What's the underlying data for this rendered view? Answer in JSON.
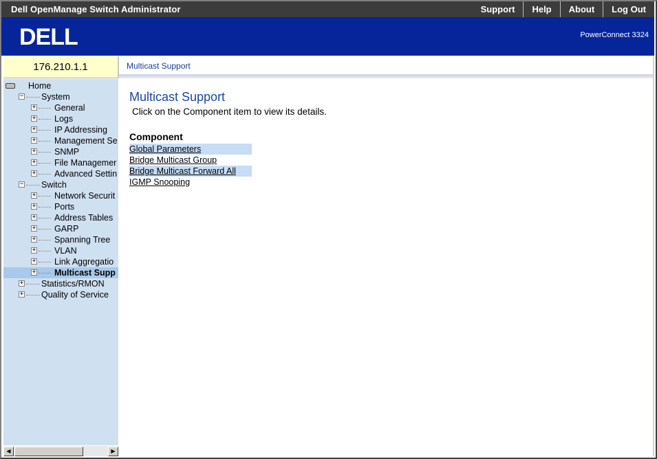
{
  "app": {
    "title": "Dell OpenManage Switch Administrator",
    "top_links": [
      "Support",
      "Help",
      "About",
      "Log Out"
    ],
    "logo_text": "DELL",
    "product": "PowerConnect 3324"
  },
  "device": {
    "ip": "176.210.1.1"
  },
  "breadcrumb": "Multicast Support",
  "tree": {
    "root": "Home",
    "items": [
      {
        "label": "System",
        "level": 1,
        "expander": "−"
      },
      {
        "label": "General",
        "level": 2,
        "expander": "+"
      },
      {
        "label": "Logs",
        "level": 2,
        "expander": "+"
      },
      {
        "label": "IP Addressing",
        "level": 2,
        "expander": "+"
      },
      {
        "label": "Management Se",
        "level": 2,
        "expander": "+"
      },
      {
        "label": "SNMP",
        "level": 2,
        "expander": "+"
      },
      {
        "label": "File Managemer",
        "level": 2,
        "expander": "+"
      },
      {
        "label": "Advanced Settin",
        "level": 2,
        "expander": "+"
      },
      {
        "label": "Switch",
        "level": 1,
        "expander": "−"
      },
      {
        "label": "Network Securit",
        "level": 2,
        "expander": "+"
      },
      {
        "label": "Ports",
        "level": 2,
        "expander": "+"
      },
      {
        "label": "Address Tables",
        "level": 2,
        "expander": "+"
      },
      {
        "label": "GARP",
        "level": 2,
        "expander": "+"
      },
      {
        "label": "Spanning Tree",
        "level": 2,
        "expander": "+"
      },
      {
        "label": "VLAN",
        "level": 2,
        "expander": "+"
      },
      {
        "label": "Link Aggregatio",
        "level": 2,
        "expander": "+"
      },
      {
        "label": "Multicast Supp",
        "level": 2,
        "expander": "+",
        "selected": true
      },
      {
        "label": "Statistics/RMON",
        "level": 1,
        "expander": "+"
      },
      {
        "label": "Quality of Service",
        "level": 1,
        "expander": "+"
      }
    ]
  },
  "main": {
    "title": "Multicast Support",
    "hint": "Click on the Component item to view its details.",
    "component_header": "Component",
    "components": [
      "Global Parameters",
      "Bridge Multicast Group",
      "Bridge Multicast Forward All",
      "IGMP Snooping"
    ]
  },
  "scrollbar": {
    "left_arrow": "◀",
    "right_arrow": "▶"
  }
}
